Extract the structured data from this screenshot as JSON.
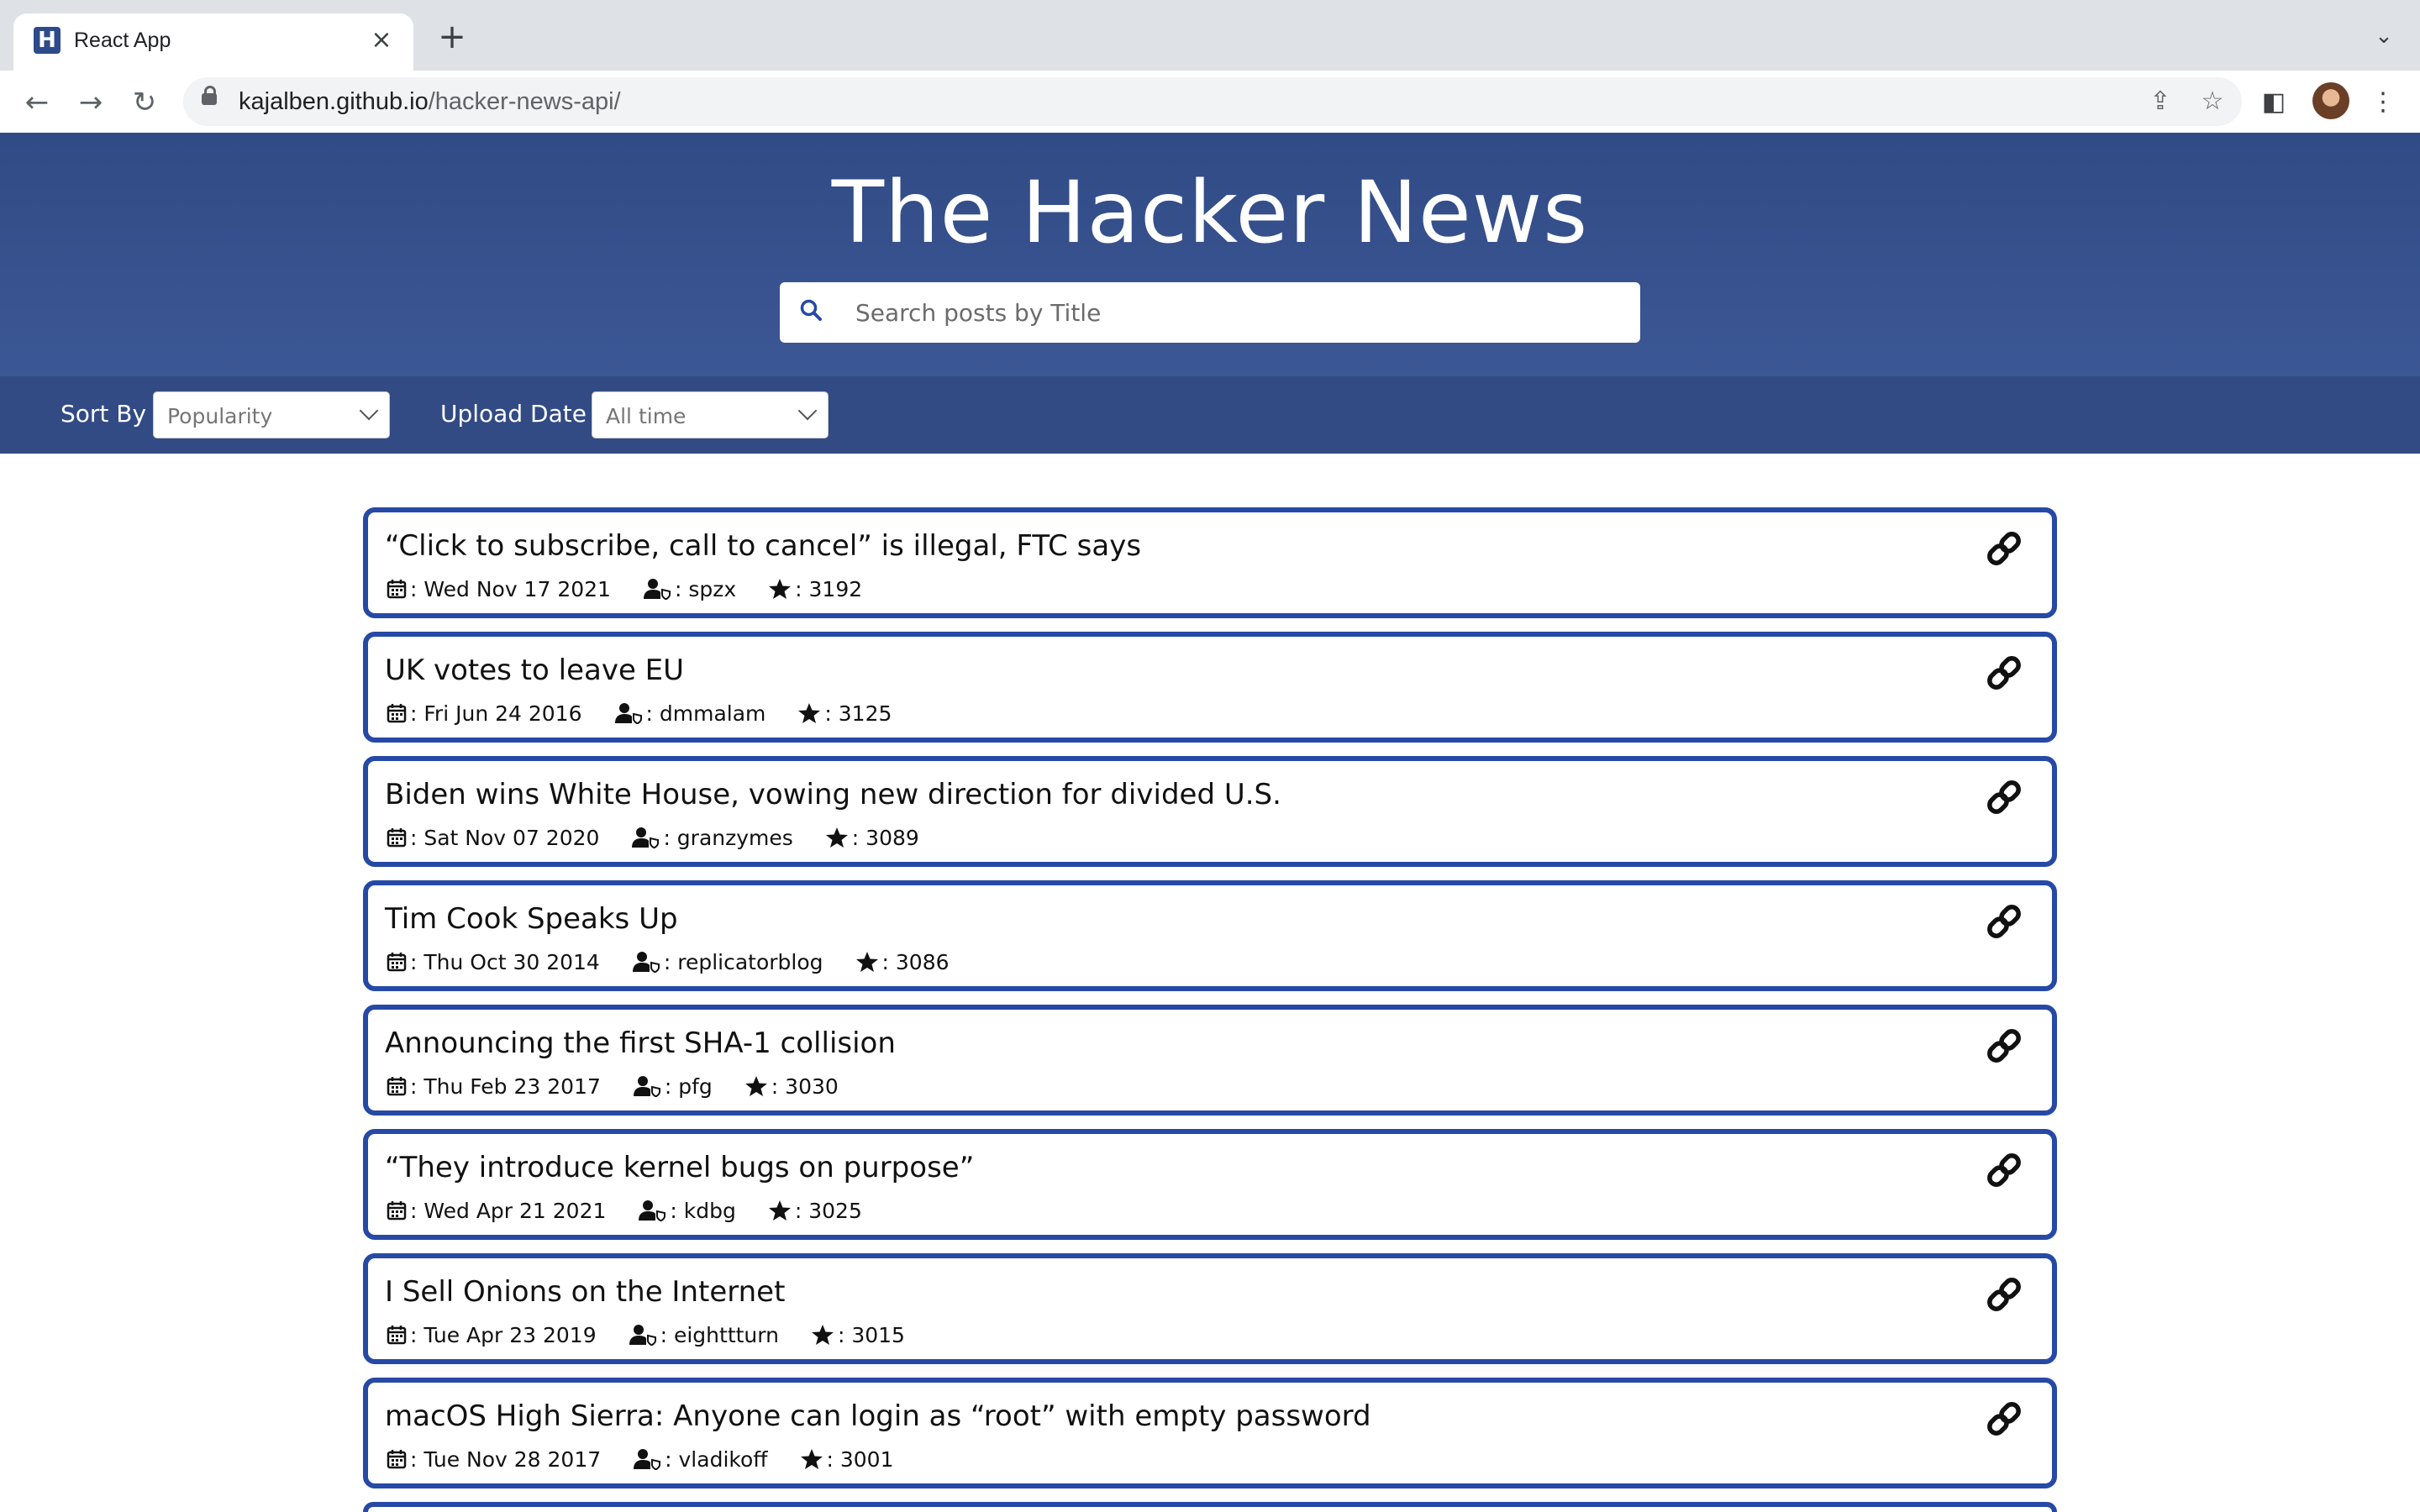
{
  "browser": {
    "tab_title": "React App",
    "tab_favicon_letter": "H",
    "url_host": "kajalben.github.io",
    "url_path": "/hacker-news-api/"
  },
  "header": {
    "title": "The Hacker News",
    "search_placeholder": "Search posts by Title"
  },
  "filters": {
    "sort_label": "Sort By",
    "sort_value": "Popularity",
    "date_label": "Upload Date",
    "date_value": "All time"
  },
  "posts": [
    {
      "title": "“Click to subscribe, call to cancel” is illegal, FTC says",
      "date": ": Wed Nov 17 2021",
      "author": ": spzx",
      "points": ": 3192"
    },
    {
      "title": "UK votes to leave EU",
      "date": ": Fri Jun 24 2016",
      "author": ": dmmalam",
      "points": ": 3125"
    },
    {
      "title": "Biden wins White House, vowing new direction for divided U.S.",
      "date": ": Sat Nov 07 2020",
      "author": ": granzymes",
      "points": ": 3089"
    },
    {
      "title": "Tim Cook Speaks Up",
      "date": ": Thu Oct 30 2014",
      "author": ": replicatorblog",
      "points": ": 3086"
    },
    {
      "title": "Announcing the first SHA-1 collision",
      "date": ": Thu Feb 23 2017",
      "author": ": pfg",
      "points": ": 3030"
    },
    {
      "title": "“They introduce kernel bugs on purpose”",
      "date": ": Wed Apr 21 2021",
      "author": ": kdbg",
      "points": ": 3025"
    },
    {
      "title": "I Sell Onions on the Internet",
      "date": ": Tue Apr 23 2019",
      "author": ": eighttturn",
      "points": ": 3015"
    },
    {
      "title": "macOS High Sierra: Anyone can login as “root” with empty password",
      "date": ": Tue Nov 28 2017",
      "author": ": vladikoff",
      "points": ": 3001"
    }
  ],
  "colors": {
    "header_bg": "#344f8c",
    "filter_bg": "#324b85",
    "card_border": "#2649a6"
  }
}
